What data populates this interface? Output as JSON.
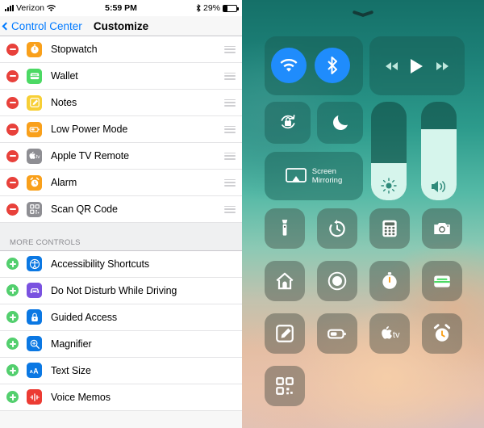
{
  "status_bar": {
    "signal_icon": "cellular-signal-icon",
    "carrier": "Verizon",
    "wifi_icon": "wifi-icon",
    "time": "5:59 PM",
    "bluetooth_icon": "bluetooth-icon",
    "battery_percent": "29%",
    "battery_icon": "battery-icon",
    "battery_level": 29
  },
  "nav": {
    "back_icon": "chevron-left-icon",
    "back_label": "Control Center",
    "title": "Customize"
  },
  "included": {
    "rows": [
      {
        "label": "Stopwatch",
        "icon": "stopwatch-icon",
        "icon_color": "#f9a01b",
        "action": "remove",
        "handle": "reorder-handle"
      },
      {
        "label": "Wallet",
        "icon": "wallet-icon",
        "icon_color": "#4cd964",
        "action": "remove",
        "handle": "reorder-handle"
      },
      {
        "label": "Notes",
        "icon": "notes-icon",
        "icon_color": "#f7cf36",
        "action": "remove",
        "handle": "reorder-handle"
      },
      {
        "label": "Low Power Mode",
        "icon": "low-power-mode-icon",
        "icon_color": "#f9a01b",
        "action": "remove",
        "handle": "reorder-handle"
      },
      {
        "label": "Apple TV Remote",
        "icon": "apple-tv-remote-icon",
        "icon_color": "#8e8e93",
        "action": "remove",
        "handle": "reorder-handle"
      },
      {
        "label": "Alarm",
        "icon": "alarm-icon",
        "icon_color": "#f9a01b",
        "action": "remove",
        "handle": "reorder-handle"
      },
      {
        "label": "Scan QR Code",
        "icon": "qr-code-icon",
        "icon_color": "#8e8e93",
        "action": "remove",
        "handle": "reorder-handle"
      }
    ]
  },
  "more_controls": {
    "header": "MORE CONTROLS",
    "rows": [
      {
        "label": "Accessibility Shortcuts",
        "icon": "accessibility-icon",
        "icon_color": "#0b78e3",
        "action": "add"
      },
      {
        "label": "Do Not Disturb While Driving",
        "icon": "car-icon",
        "icon_color": "#7a52e0",
        "action": "add"
      },
      {
        "label": "Guided Access",
        "icon": "lock-icon",
        "icon_color": "#0b78e3",
        "action": "add"
      },
      {
        "label": "Magnifier",
        "icon": "magnifier-icon",
        "icon_color": "#0b78e3",
        "action": "add"
      },
      {
        "label": "Text Size",
        "icon": "text-size-icon",
        "icon_color": "#0b78e3",
        "action": "add",
        "glyph": "AA"
      },
      {
        "label": "Voice Memos",
        "icon": "voice-memos-icon",
        "icon_color": "#ec3b33",
        "action": "add"
      }
    ]
  },
  "control_center": {
    "grabber_icon": "chevron-down-icon",
    "connectivity": {
      "wifi": {
        "icon": "wifi-icon",
        "state": "on",
        "color": "#1f8cfc"
      },
      "bluetooth": {
        "icon": "bluetooth-icon",
        "state": "on",
        "color": "#1f8cfc"
      }
    },
    "media": {
      "rewind_icon": "rewind-icon",
      "play_icon": "play-icon",
      "forward_icon": "fast-forward-icon"
    },
    "rotation_lock": {
      "icon": "rotation-lock-icon",
      "state": "off"
    },
    "do_not_disturb": {
      "icon": "moon-icon",
      "state": "off"
    },
    "screen_mirroring": {
      "icon": "screen-mirroring-icon",
      "label_line1": "Screen",
      "label_line2": "Mirroring"
    },
    "brightness": {
      "icon": "brightness-icon",
      "value": 38
    },
    "volume": {
      "icon": "volume-icon",
      "value": 72
    },
    "tiles": [
      {
        "icon": "flashlight-icon",
        "name": "Flashlight"
      },
      {
        "icon": "timer-icon",
        "name": "Timer"
      },
      {
        "icon": "calculator-icon",
        "name": "Calculator"
      },
      {
        "icon": "camera-icon",
        "name": "Camera"
      },
      {
        "icon": "home-icon",
        "name": "Home"
      },
      {
        "icon": "screen-record-icon",
        "name": "Screen Recording"
      },
      {
        "icon": "stopwatch-icon",
        "name": "Stopwatch"
      },
      {
        "icon": "wallet-icon",
        "name": "Wallet"
      },
      {
        "icon": "notes-icon",
        "name": "Notes"
      },
      {
        "icon": "low-power-mode-icon",
        "name": "Low Power Mode"
      },
      {
        "icon": "apple-tv-icon",
        "name": "Apple TV Remote"
      },
      {
        "icon": "alarm-icon",
        "name": "Alarm"
      },
      {
        "icon": "qr-code-icon",
        "name": "Scan QR Code"
      }
    ]
  }
}
